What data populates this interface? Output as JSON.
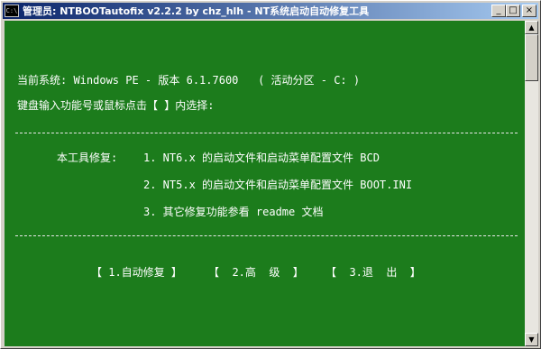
{
  "window": {
    "title": "管理员: NTBOOTautofix v2.2.2 by chz_hlh - NT系统启动自动修复工具",
    "icon_label": "C:\\",
    "minimize_glyph": "_",
    "maximize_glyph": "□",
    "close_glyph": "×"
  },
  "console": {
    "background": "#1c7c1c",
    "system_line": "当前系统: Windows PE - 版本 6.1.7600   ( 活动分区 - C: )",
    "prompt_line": "键盘输入功能号或鼠标点击【 】内选择:",
    "repair_label": "本工具修复:",
    "repair_items": [
      "1. NT6.x 的启动文件和启动菜单配置文件 BCD",
      "2. NT5.x 的启动文件和启动菜单配置文件 BOOT.INI",
      "3. 其它修复功能参看 readme 文档"
    ],
    "menu": [
      {
        "label": "【 1.自动修复 】"
      },
      {
        "label": "【  2.高  级  】"
      },
      {
        "label": "【  3.退  出  】"
      }
    ]
  },
  "scrollbar": {
    "up_glyph": "▲",
    "down_glyph": "▼"
  }
}
